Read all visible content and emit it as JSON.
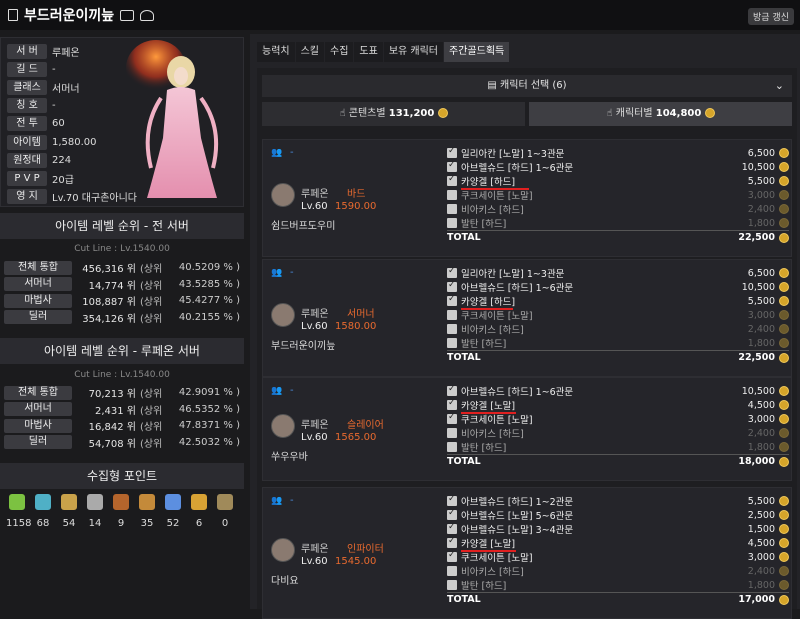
{
  "header": {
    "title": "부드러운이끼늪",
    "refresh": "방금 갱신"
  },
  "profile": [
    {
      "k": "서 버",
      "v": "루페온"
    },
    {
      "k": "길 드",
      "v": "-"
    },
    {
      "k": "클래스",
      "v": "서머너"
    },
    {
      "k": "칭 호",
      "v": "-"
    },
    {
      "k": "전 투",
      "v": "60"
    },
    {
      "k": "아이템",
      "v": "1,580.00"
    },
    {
      "k": "원정대",
      "v": "224"
    },
    {
      "k": "P V P",
      "v": "20급"
    },
    {
      "k": "영 지",
      "v": "Lv.70 대구촌아니다"
    }
  ],
  "rank_all": {
    "title": "아이템 레벨 순위 - 전 서버",
    "cutline": "Cut Line : Lv.1540.00",
    "rows": [
      {
        "k": "전체 통합",
        "v": "456,316 위",
        "u": "(상위",
        "s": "40.5209 % )"
      },
      {
        "k": "서머너",
        "v": "14,774 위",
        "u": "(상위",
        "s": "43.5285 % )"
      },
      {
        "k": "마법사",
        "v": "108,887 위",
        "u": "(상위",
        "s": "45.4277 % )"
      },
      {
        "k": "딜러",
        "v": "354,126 위",
        "u": "(상위",
        "s": "40.2155 % )"
      }
    ]
  },
  "rank_server": {
    "title": "아이템 레벨 순위 - 루페온 서버",
    "cutline": "Cut Line : Lv.1540.00",
    "rows": [
      {
        "k": "전체 통합",
        "v": "70,213 위",
        "u": "(상위",
        "s": "42.9091 % )"
      },
      {
        "k": "서머너",
        "v": "2,431 위",
        "u": "(상위",
        "s": "46.5352 % )"
      },
      {
        "k": "마법사",
        "v": "16,842 위",
        "u": "(상위",
        "s": "47.8371 % )"
      },
      {
        "k": "딜러",
        "v": "54,708 위",
        "u": "(상위",
        "s": "42.5032 % )"
      }
    ]
  },
  "collection": {
    "title": "수집형 포인트",
    "items": [
      {
        "icon": "seed-icon",
        "v": "1158",
        "color": "#7cc241"
      },
      {
        "icon": "island-heart-icon",
        "v": "68",
        "color": "#4fb0c6"
      },
      {
        "icon": "art-icon",
        "v": "54",
        "color": "#c9a24a"
      },
      {
        "icon": "giant-heart-icon",
        "v": "14",
        "color": "#aaaaaa"
      },
      {
        "icon": "ignea-icon",
        "v": "9",
        "color": "#b5652c"
      },
      {
        "icon": "voyage-icon",
        "v": "35",
        "color": "#c48a3a"
      },
      {
        "icon": "leaf-icon",
        "v": "52",
        "color": "#5c8fe0"
      },
      {
        "icon": "star-icon",
        "v": "6",
        "color": "#d8a234"
      },
      {
        "icon": "orpheus-icon",
        "v": "0",
        "color": "#a08a5a"
      }
    ]
  },
  "tabs": [
    "능력치",
    "스킬",
    "수집",
    "도표",
    "보유 캐릭터",
    "주간골드획득"
  ],
  "selector": "캐릭터 선택 (6)",
  "totals": {
    "content_label": "콘텐츠별",
    "content_value": "131,200",
    "char_label": "캐릭터별",
    "char_value": "104,800"
  },
  "cards": [
    {
      "server": "루페온",
      "class": "바드",
      "level": "Lv.60",
      "ilvl": "1590.00",
      "name": "쉼드버프도우미",
      "raids": [
        {
          "n": "일리아칸 [노말] 1~3관문",
          "g": "6,500",
          "on": true
        },
        {
          "n": "아브렐슈드 [하드] 1~6관문",
          "g": "10,500",
          "on": true
        },
        {
          "n": "카양겔 [하드]",
          "g": "5,500",
          "on": true,
          "ul": 68
        },
        {
          "n": "쿠크세이튼 [노말]",
          "g": "3,000",
          "on": false
        },
        {
          "n": "비아키스 [하드]",
          "g": "2,400",
          "on": false
        },
        {
          "n": "발탄 [하드]",
          "g": "1,800",
          "on": false
        }
      ],
      "total_label": "TOTAL",
      "total": "22,500"
    },
    {
      "server": "루페온",
      "class": "서머너",
      "level": "Lv.60",
      "ilvl": "1580.00",
      "name": "부드러운이끼늪",
      "raids": [
        {
          "n": "일리아칸 [노말] 1~3관문",
          "g": "6,500",
          "on": true
        },
        {
          "n": "아브렐슈드 [하드] 1~6관문",
          "g": "10,500",
          "on": true
        },
        {
          "n": "카양겔 [하드]",
          "g": "5,500",
          "on": true,
          "ul": 52
        },
        {
          "n": "쿠크세이튼 [노말]",
          "g": "3,000",
          "on": false
        },
        {
          "n": "비아키스 [하드]",
          "g": "2,400",
          "on": false
        },
        {
          "n": "발탄 [하드]",
          "g": "1,800",
          "on": false
        }
      ],
      "total_label": "TOTAL",
      "total": "22,500"
    },
    {
      "server": "루페온",
      "class": "슬레이어",
      "level": "Lv.60",
      "ilvl": "1565.00",
      "name": "쑤우우바",
      "raids": [
        {
          "n": "아브렐슈드 [하드] 1~6관문",
          "g": "10,500",
          "on": true
        },
        {
          "n": "카양겔 [노말]",
          "g": "4,500",
          "on": true,
          "ul": 55
        },
        {
          "n": "쿠크세이튼 [노말]",
          "g": "3,000",
          "on": true
        },
        {
          "n": "비아키스 [하드]",
          "g": "2,400",
          "on": false
        },
        {
          "n": "발탄 [하드]",
          "g": "1,800",
          "on": false
        }
      ],
      "total_label": "TOTAL",
      "total": "18,000"
    },
    {
      "server": "루페온",
      "class": "인파이터",
      "level": "Lv.60",
      "ilvl": "1545.00",
      "name": "다비요",
      "raids": [
        {
          "n": "아브렐슈드 [하드] 1~2관문",
          "g": "5,500",
          "on": true
        },
        {
          "n": "아브렐슈드 [노말] 5~6관문",
          "g": "2,500",
          "on": true
        },
        {
          "n": "아브렐슈드 [노말] 3~4관문",
          "g": "1,500",
          "on": true
        },
        {
          "n": "카양겔 [노말]",
          "g": "4,500",
          "on": true,
          "ul": 55
        },
        {
          "n": "쿠크세이튼 [노말]",
          "g": "3,000",
          "on": true
        },
        {
          "n": "비아키스 [하드]",
          "g": "2,400",
          "on": false
        },
        {
          "n": "발탄 [하드]",
          "g": "1,800",
          "on": false
        }
      ],
      "total_label": "TOTAL",
      "total": "17,000"
    }
  ]
}
